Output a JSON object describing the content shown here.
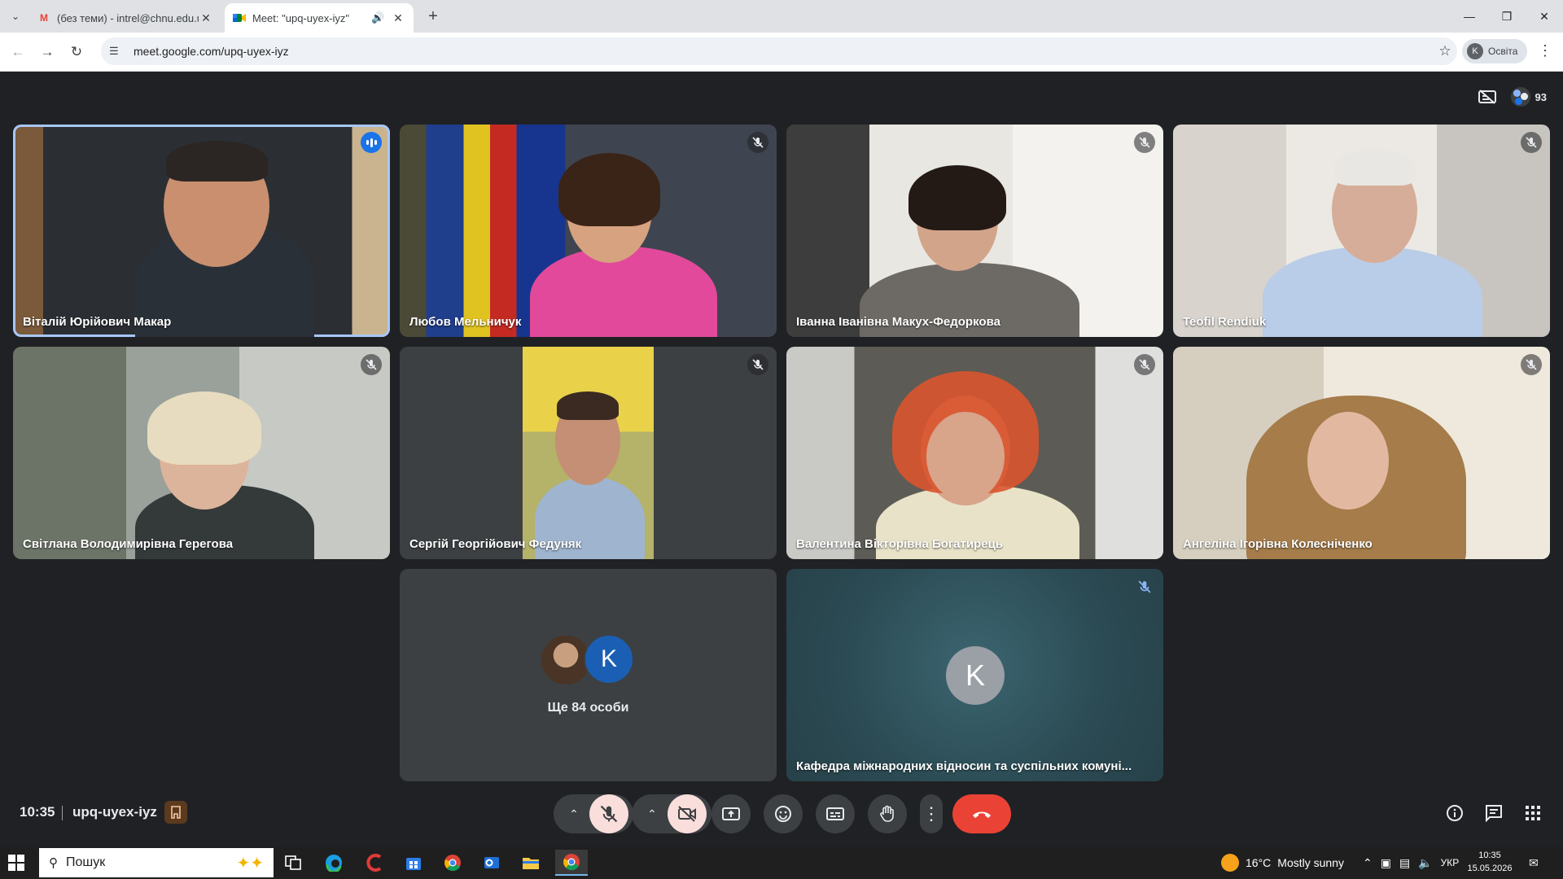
{
  "browser": {
    "tabs": [
      {
        "title": "(без теми) - intrel@chnu.edu.ua",
        "favicon": "gmail-icon",
        "active": false
      },
      {
        "title": "Meet: \"upq-uyex-iyz\"",
        "favicon": "meet-icon",
        "active": true
      }
    ],
    "url": "meet.google.com/upq-uyex-iyz",
    "profile_initial": "K",
    "profile_name": "Освіта"
  },
  "meet": {
    "participant_count": "93",
    "tiles": [
      {
        "name": "Віталій Юрійович Макар",
        "state": "speaking"
      },
      {
        "name": "Любов Мельничук",
        "state": "muted"
      },
      {
        "name": "Іванна Іванівна Макух-Федоркова",
        "state": "muted"
      },
      {
        "name": "Teofil Rendiuk",
        "state": "muted"
      },
      {
        "name": "Світлана Володимирівна Герегова",
        "state": "muted"
      },
      {
        "name": "Сергій Георгійович Федуняк",
        "state": "muted"
      },
      {
        "name": "Валентина Вікторівна Богатирець",
        "state": "muted"
      },
      {
        "name": "Ангеліна Ігорівна Колесніченко",
        "state": "muted"
      }
    ],
    "more": {
      "avatar_initial": "K",
      "label": "Ще 84 особи"
    },
    "presenter_tile": {
      "initial": "K",
      "name": "Кафедра міжнародних відносин та суспільних комуні..."
    },
    "time": "10:35",
    "meeting_code": "upq-uyex-iyz",
    "colors": {
      "hangup": "#ea4335",
      "mic_off_bg": "#f9dedc",
      "speaking_ring": "#a8c7fa",
      "speaking_badge": "#1a73e8"
    }
  },
  "taskbar": {
    "search_placeholder": "Пошук",
    "weather_temp": "16°C",
    "weather_text": "Mostly sunny",
    "language": "УКР",
    "clock_time": "10:35",
    "clock_date": "15.05.2026"
  }
}
